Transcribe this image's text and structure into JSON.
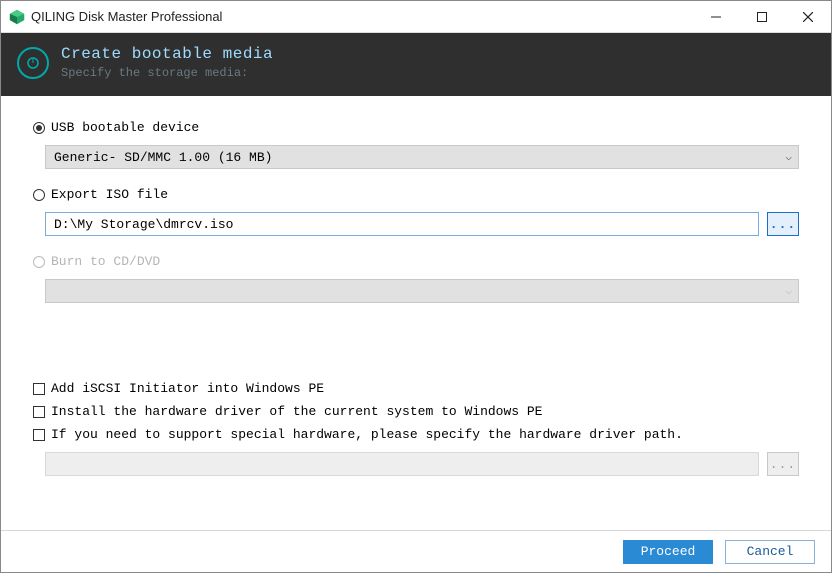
{
  "window": {
    "title": "QILING Disk Master Professional"
  },
  "header": {
    "title": "Create bootable media",
    "subtitle": "Specify the storage media:"
  },
  "options": {
    "usb": {
      "label": "USB bootable device",
      "selected": "Generic- SD/MMC 1.00 (16 MB)"
    },
    "iso": {
      "label": "Export ISO file",
      "path": "D:\\My Storage\\dmrcv.iso",
      "browse": "..."
    },
    "cd": {
      "label": "Burn to CD/DVD",
      "selected": ""
    }
  },
  "checks": {
    "iscsi": "Add iSCSI Initiator into Windows PE",
    "hwdriver": "Install the hardware driver of the current system to Windows PE",
    "special": "If you need to support special hardware, please specify the hardware driver path.",
    "driver_browse": "..."
  },
  "footer": {
    "proceed": "Proceed",
    "cancel": "Cancel"
  }
}
